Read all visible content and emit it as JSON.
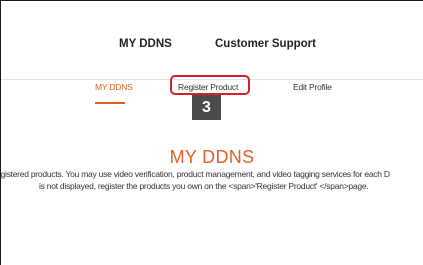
{
  "top_nav": {
    "my_ddns": "MY DDNS",
    "customer_support": "Customer Support"
  },
  "sub_nav": {
    "my_ddns": "MY DDNS",
    "register_product": "Register Product",
    "edit_profile": "Edit Profile"
  },
  "annotation": {
    "step_number": "3",
    "highlight_color": "#d8202a"
  },
  "main": {
    "heading": "MY DDNS",
    "description_line1": "egistered products. You may use video verification, product management, and video tagging services for each D",
    "description_line2": "is not displayed, register the products you own on the <span>'Register Product' </span>page."
  },
  "colors": {
    "accent": "#e0602a",
    "text": "#333333",
    "badge": "#4b4b4b"
  }
}
